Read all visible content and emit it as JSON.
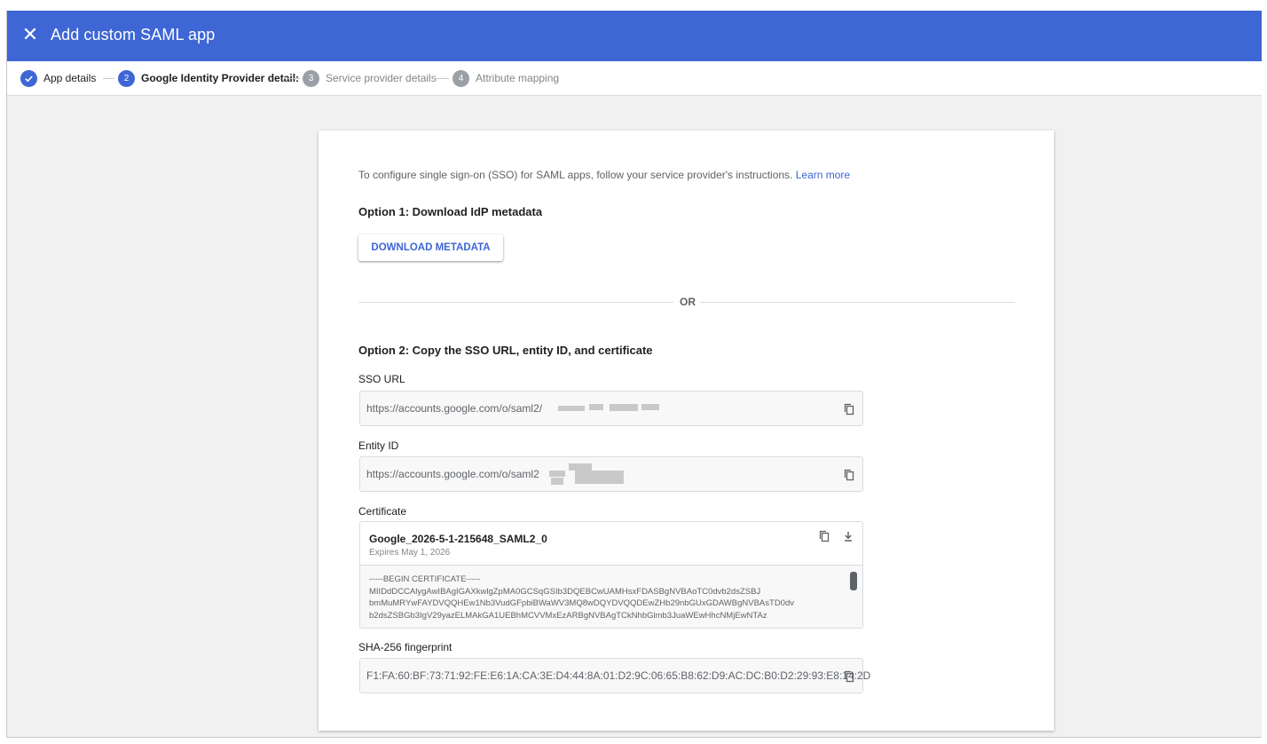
{
  "header": {
    "title": "Add custom SAML app",
    "close_icon": "close-icon",
    "color": "#3e66d4"
  },
  "stepper": {
    "steps": [
      {
        "number": "✓",
        "label": "App details",
        "state": "done"
      },
      {
        "number": "2",
        "label": "Google Identity Provider detail:",
        "state": "current"
      },
      {
        "number": "3",
        "label": "Service provider details",
        "state": "todo"
      },
      {
        "number": "4",
        "label": "Attribute mapping",
        "state": "todo"
      }
    ]
  },
  "main": {
    "intro_text": "To configure single sign-on (SSO) for SAML apps, follow your service provider's instructions.",
    "learn_more": "Learn more",
    "option1_title": "Option 1: Download IdP metadata",
    "download_button": "DOWNLOAD METADATA",
    "or_text": "OR",
    "option2_title": "Option 2: Copy the SSO URL, entity ID, and certificate",
    "sso_url": {
      "label": "SSO URL",
      "value": "https://accounts.google.com/o/saml2/"
    },
    "entity_id": {
      "label": "Entity ID",
      "value": "https://accounts.google.com/o/saml2"
    },
    "certificate": {
      "label": "Certificate",
      "name": "Google_2026-5-1-215648_SAML2_0",
      "expires": "Expires May 1, 2026",
      "body": "-----BEGIN CERTIFICATE-----\nMIIDdDCCAlygAwIBAgIGAXkwlgZpMA0GCSqGSIb3DQEBCwUAMHsxFDASBgNVBAoTC0dvb2dsZSBJ\nbmMuMRYwFAYDVQQHEw1Nb3VudGFpbiBWaWV3MQ8wDQYDVQQDEwZHb29nbGUxGDAWBgNVBAsTD0dv\nb2dsZSBGb3IgV29yazELMAkGA1UEBhMCVVMxEzARBgNVBAgTCkNhbGlmb3JuaWEwHhcNMjEwNTAz"
    },
    "fingerprint": {
      "label": "SHA-256 fingerprint",
      "value": "F1:FA:60:BF:73:71:92:FE:E6:1A:CA:3E:D4:44:8A:01:D2:9C:06:65:B8:62:D9:AC:DC:B0:D2:29:93:E8:14:2D"
    }
  },
  "icons": {
    "copy": "copy-icon",
    "download": "download-icon",
    "check": "check-icon"
  }
}
